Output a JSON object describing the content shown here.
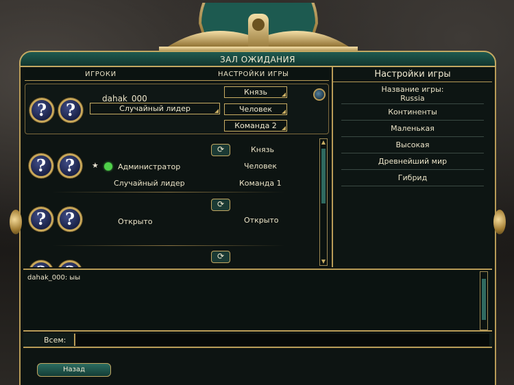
{
  "window": {
    "title": "ЗАЛ ОЖИДАНИЯ"
  },
  "headers": {
    "players": "ИГРОКИ",
    "game_settings": "НАСТРОЙКИ ИГРЫ"
  },
  "me": {
    "name": "dahak_000",
    "leader": "Случайный лидер",
    "civ": "Князь",
    "type": "Человек",
    "team": "Команда 2"
  },
  "players": [
    {
      "status": "Администратор",
      "leader": "Случайный лидер",
      "civ": "Князь",
      "type": "Человек",
      "team": "Команда 1"
    },
    {
      "status": "Открыто",
      "type": "Открыто"
    }
  ],
  "settings": {
    "title": "Настройки игры",
    "name_label": "Название игры:",
    "name_value": "Russia",
    "map_type": "Континенты",
    "map_size": "Маленькая",
    "speed": "Высокая",
    "era": "Древнейший мир",
    "turn_mode": "Гибрид"
  },
  "chat": {
    "messages": [
      "dahak_000: ыы"
    ],
    "target_label": "Всем:"
  },
  "buttons": {
    "back": "Назад"
  },
  "colors": {
    "gold": "#b89b57",
    "teal": "#1f5b50",
    "online": "#4fd04a"
  }
}
